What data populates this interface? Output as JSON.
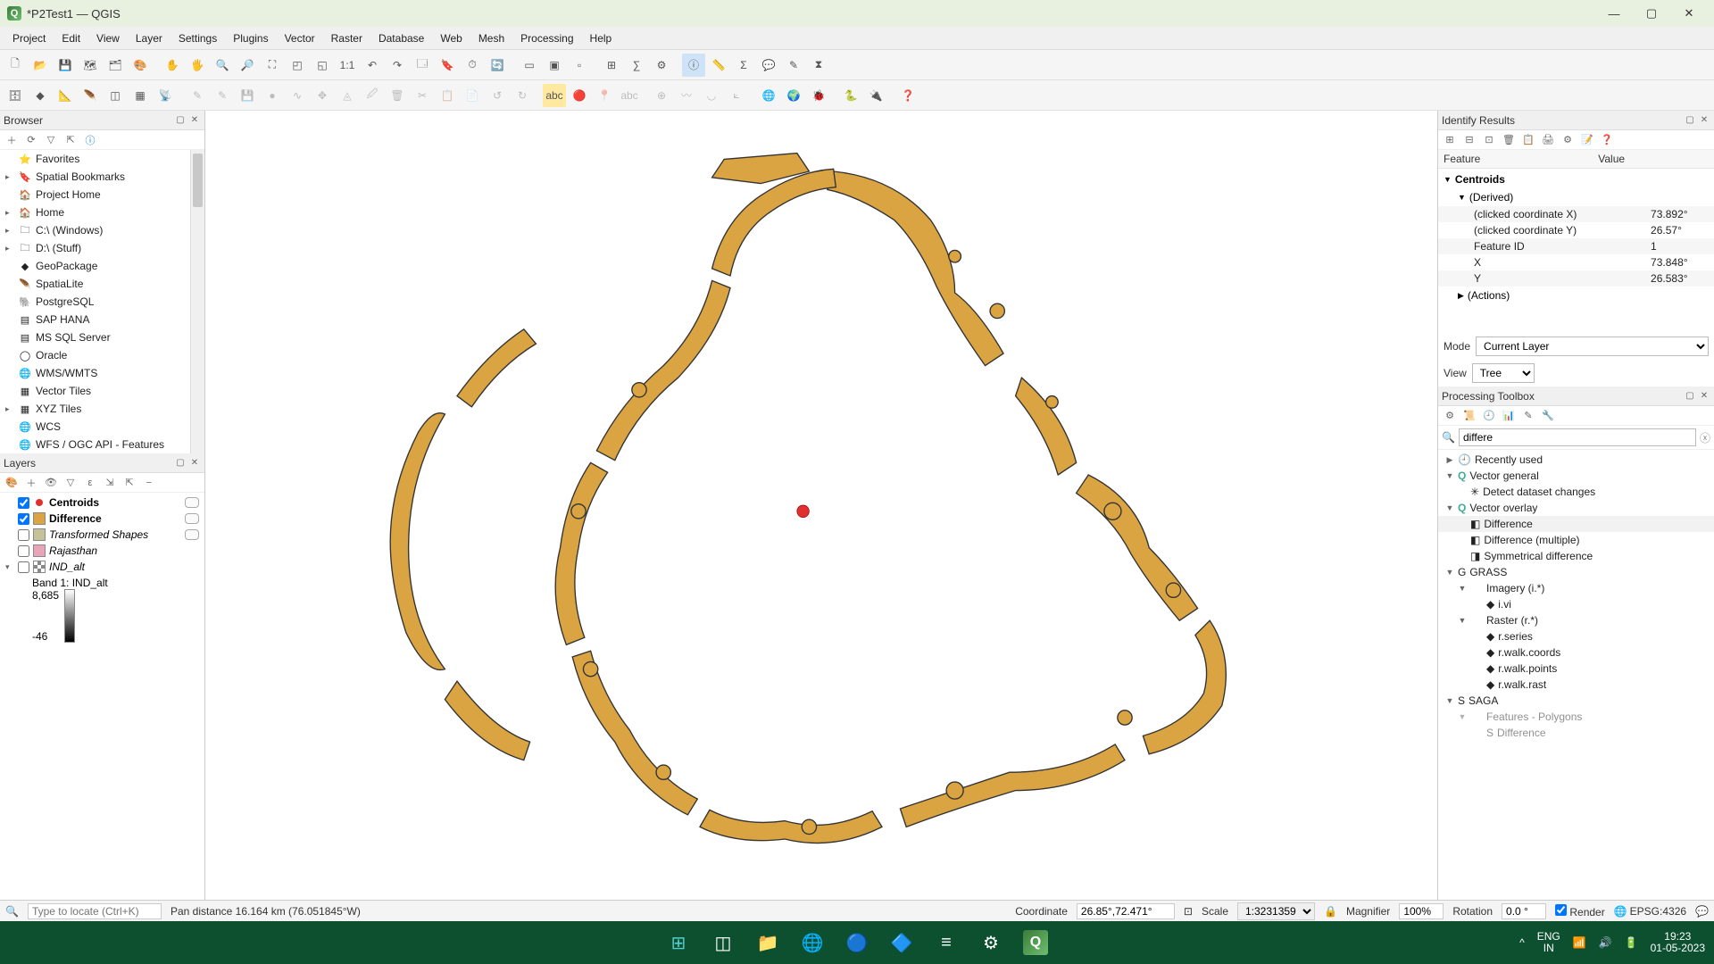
{
  "app": {
    "title": "*P2Test1 — QGIS"
  },
  "menu": [
    "Project",
    "Edit",
    "View",
    "Layer",
    "Settings",
    "Plugins",
    "Vector",
    "Raster",
    "Database",
    "Web",
    "Mesh",
    "Processing",
    "Help"
  ],
  "browser": {
    "title": "Browser",
    "items": [
      {
        "label": "Favorites",
        "icon": "⭐"
      },
      {
        "label": "Spatial Bookmarks",
        "icon": "🔖",
        "expandable": true
      },
      {
        "label": "Project Home",
        "icon": "🏠"
      },
      {
        "label": "Home",
        "icon": "🏠",
        "expandable": true
      },
      {
        "label": "C:\\ (Windows)",
        "icon": "🗀",
        "expandable": true
      },
      {
        "label": "D:\\ (Stuff)",
        "icon": "🗀",
        "expandable": true
      },
      {
        "label": "GeoPackage",
        "icon": "◆"
      },
      {
        "label": "SpatiaLite",
        "icon": "🪶"
      },
      {
        "label": "PostgreSQL",
        "icon": "🐘"
      },
      {
        "label": "SAP HANA",
        "icon": "▤"
      },
      {
        "label": "MS SQL Server",
        "icon": "▤"
      },
      {
        "label": "Oracle",
        "icon": "◯"
      },
      {
        "label": "WMS/WMTS",
        "icon": "🌐"
      },
      {
        "label": "Vector Tiles",
        "icon": "▦"
      },
      {
        "label": "XYZ Tiles",
        "icon": "▦",
        "expandable": true
      },
      {
        "label": "WCS",
        "icon": "🌐"
      },
      {
        "label": "WFS / OGC API - Features",
        "icon": "🌐"
      }
    ]
  },
  "layers": {
    "title": "Layers",
    "items": [
      {
        "checked": true,
        "name": "Centroids",
        "swatch": "point-red",
        "bold": true,
        "badge": true
      },
      {
        "checked": true,
        "name": "Difference",
        "swatch": "#d9a441",
        "bold": true,
        "badge": true
      },
      {
        "checked": false,
        "name": "Transformed Shapes",
        "swatch": "#c7c19a",
        "italic": true,
        "badge": true
      },
      {
        "checked": false,
        "name": "Rajasthan",
        "swatch": "#e9a5b8",
        "italic": true
      },
      {
        "checked": false,
        "name": "IND_alt",
        "swatch": "checker",
        "italic": true,
        "expandable": true
      }
    ],
    "band_label": "Band 1: IND_alt",
    "band_max": "8,685",
    "band_min": "-46"
  },
  "identify": {
    "title": "Identify Results",
    "columns": [
      "Feature",
      "Value"
    ],
    "layer": "Centroids",
    "derived_label": "(Derived)",
    "rows": [
      {
        "k": "(clicked coordinate X)",
        "v": "73.892°"
      },
      {
        "k": "(clicked coordinate Y)",
        "v": "26.57°"
      },
      {
        "k": "Feature ID",
        "v": "1"
      },
      {
        "k": "X",
        "v": "73.848°"
      },
      {
        "k": "Y",
        "v": "26.583°"
      }
    ],
    "actions_label": "(Actions)",
    "mode_label": "Mode",
    "mode_value": "Current Layer",
    "view_label": "View",
    "view_value": "Tree"
  },
  "toolbox": {
    "title": "Processing Toolbox",
    "search": "differe",
    "tree": [
      {
        "t": "Recently used",
        "icon": "🕘",
        "lvl": 0,
        "arrow": "▶"
      },
      {
        "t": "Vector general",
        "icon": "Q",
        "lvl": 0,
        "arrow": "▼",
        "q": true
      },
      {
        "t": "Detect dataset changes",
        "icon": "✳",
        "lvl": 1
      },
      {
        "t": "Vector overlay",
        "icon": "Q",
        "lvl": 0,
        "arrow": "▼",
        "q": true
      },
      {
        "t": "Difference",
        "icon": "◧",
        "lvl": 1,
        "sel": true
      },
      {
        "t": "Difference (multiple)",
        "icon": "◧",
        "lvl": 1
      },
      {
        "t": "Symmetrical difference",
        "icon": "◨",
        "lvl": 1
      },
      {
        "t": "GRASS",
        "icon": "G",
        "lvl": 0,
        "arrow": "▼"
      },
      {
        "t": "Imagery (i.*)",
        "icon": "",
        "lvl": 1,
        "arrow": "▼"
      },
      {
        "t": "i.vi",
        "icon": "◆",
        "lvl": 2
      },
      {
        "t": "Raster (r.*)",
        "icon": "",
        "lvl": 1,
        "arrow": "▼"
      },
      {
        "t": "r.series",
        "icon": "◆",
        "lvl": 2
      },
      {
        "t": "r.walk.coords",
        "icon": "◆",
        "lvl": 2
      },
      {
        "t": "r.walk.points",
        "icon": "◆",
        "lvl": 2
      },
      {
        "t": "r.walk.rast",
        "icon": "◆",
        "lvl": 2
      },
      {
        "t": "SAGA",
        "icon": "S",
        "lvl": 0,
        "arrow": "▼"
      },
      {
        "t": "Features - Polygons",
        "icon": "",
        "lvl": 1,
        "arrow": "▼",
        "dim": true
      },
      {
        "t": "Difference",
        "icon": "S",
        "lvl": 2,
        "dim": true
      }
    ]
  },
  "status": {
    "locator_placeholder": "Type to locate (Ctrl+K)",
    "pan_msg": "Pan distance 16.164 km (76.051845°W)",
    "coord_label": "Coordinate",
    "coord_value": "26.85°,72.471°",
    "scale_label": "Scale",
    "scale_value": "1:3231359",
    "magnifier_label": "Magnifier",
    "magnifier_value": "100%",
    "rotation_label": "Rotation",
    "rotation_value": "0.0 °",
    "render_label": "Render",
    "crs": "EPSG:4326"
  },
  "taskbar": {
    "lang1": "ENG",
    "lang2": "IN",
    "time": "19:23",
    "date": "01-05-2023"
  }
}
